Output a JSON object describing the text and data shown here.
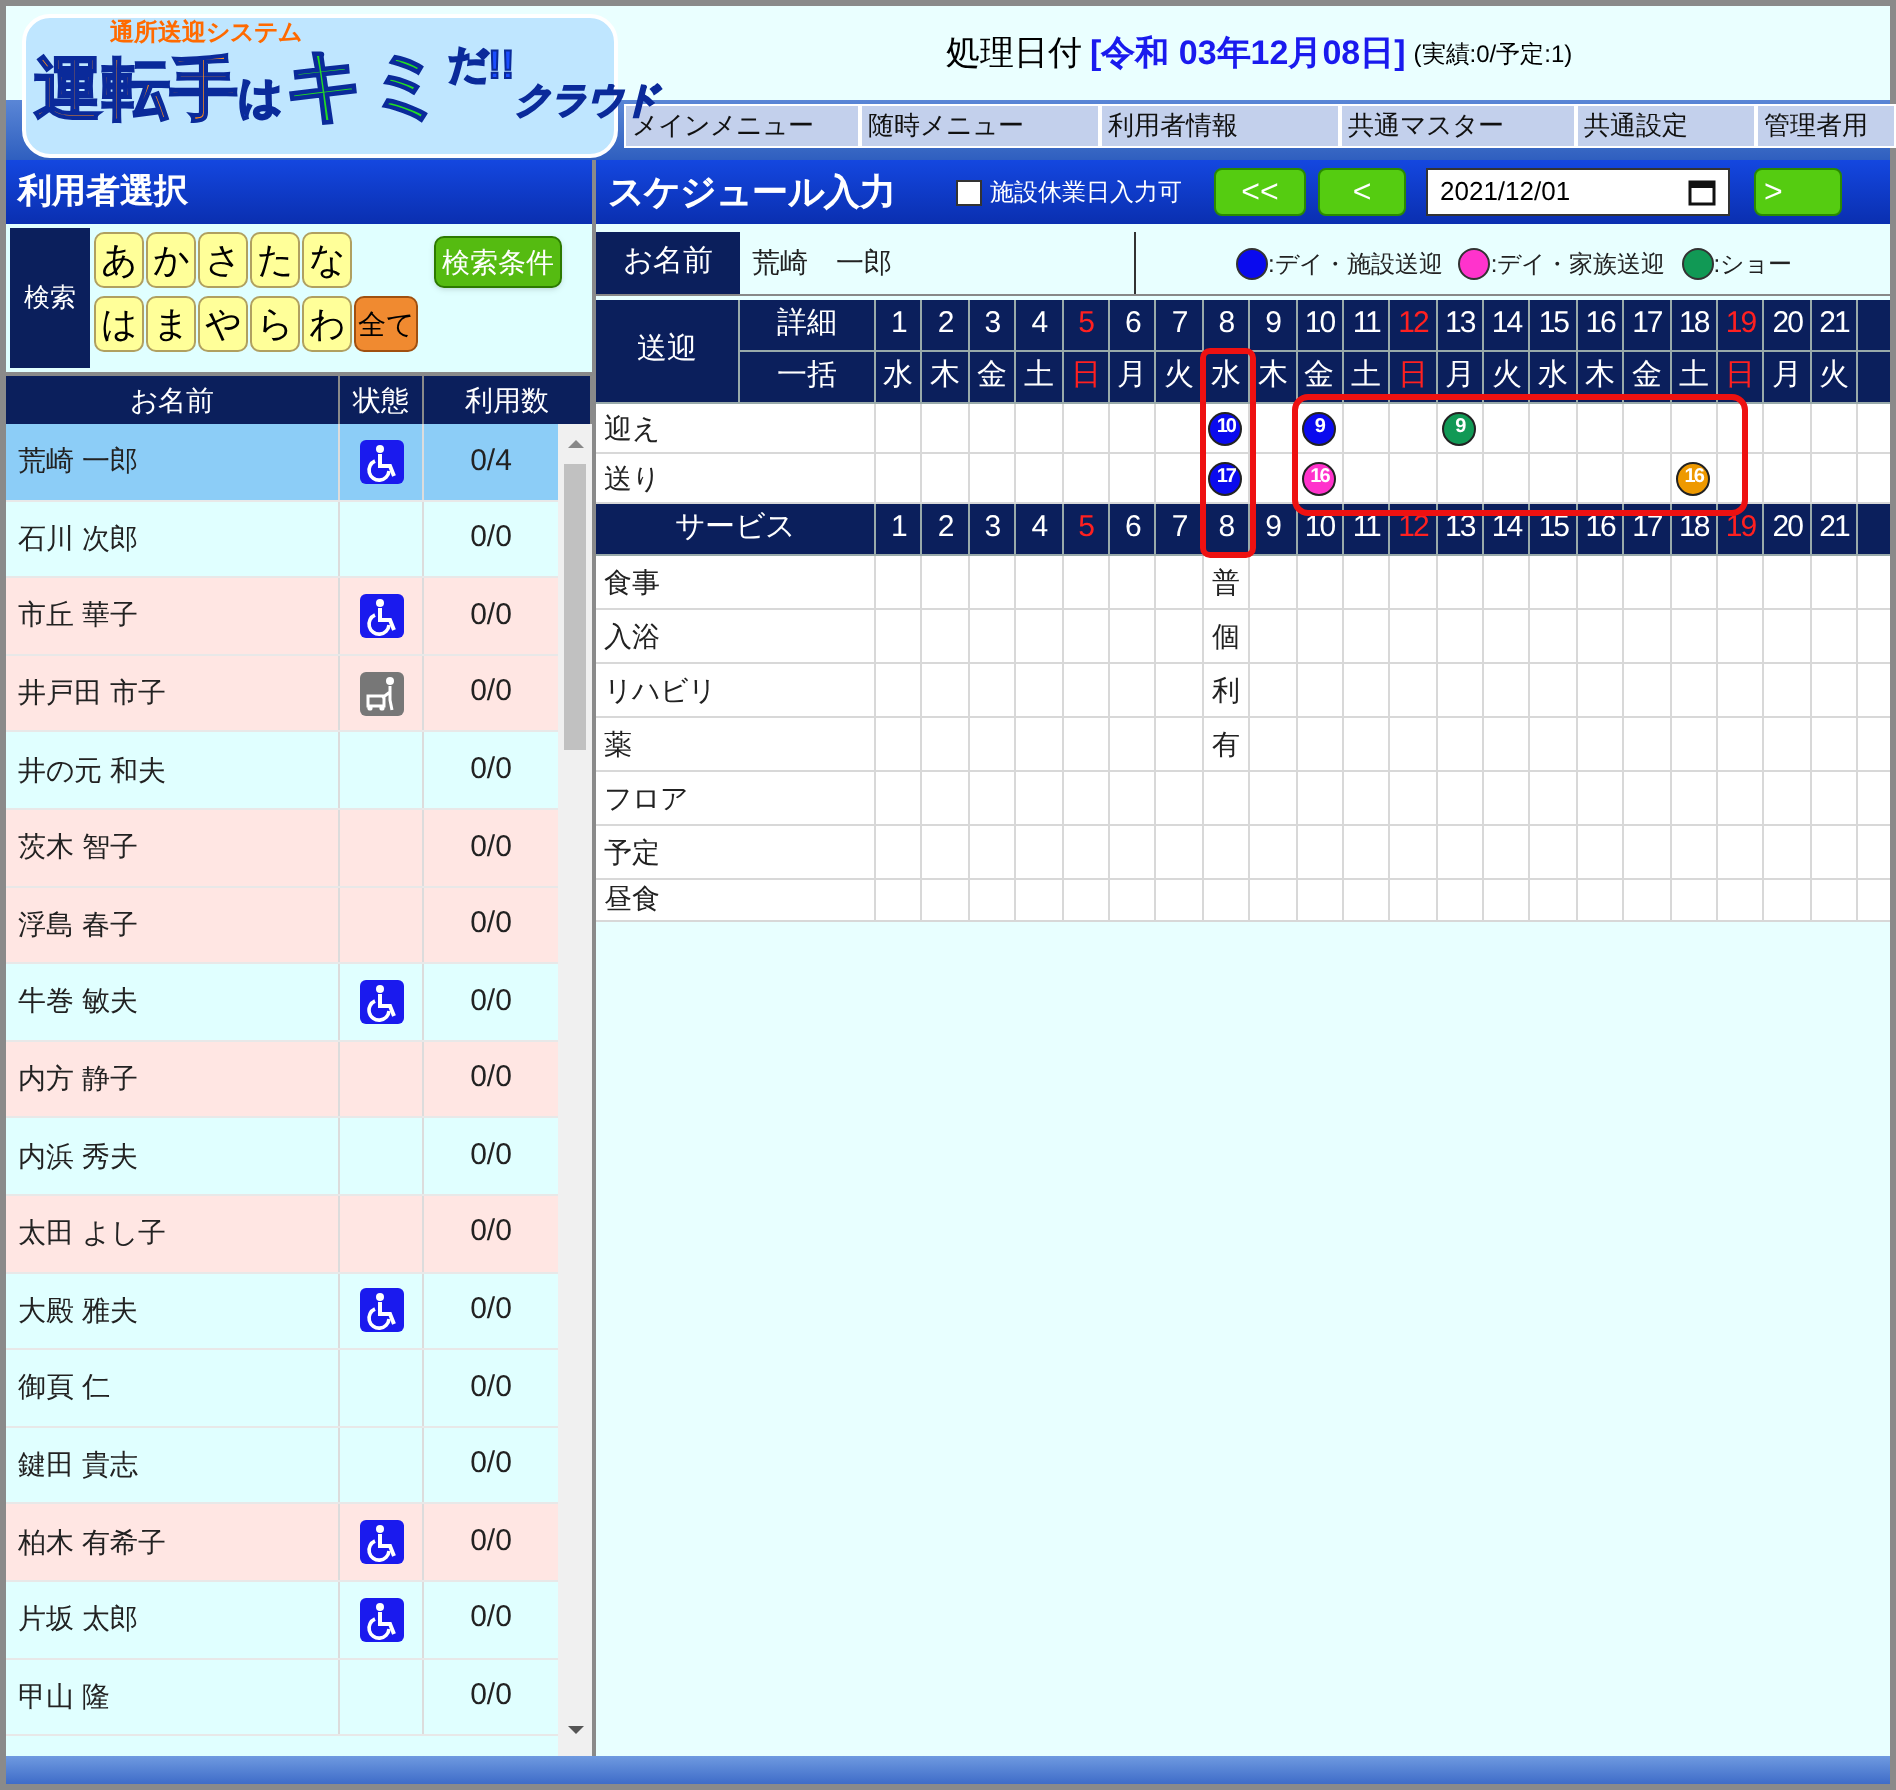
{
  "logo": {
    "tagline": "通所送迎システム",
    "parts": [
      "運転手",
      "は",
      "キミ",
      "だ!!",
      "クラウド"
    ]
  },
  "header": {
    "date_label": "処理日付",
    "date": "[令和 03年12月08日]",
    "counts": "(実績:0/予定:1)"
  },
  "nav": [
    "メインメニュー",
    "随時メニュー",
    "利用者情報",
    "共通マスター",
    "共通設定",
    "管理者用"
  ],
  "user_panel": {
    "title": "利用者選択",
    "search_label": "検索",
    "kana_rows": [
      [
        {
          "text": "あ",
          "kind": "kana"
        },
        {
          "text": "か",
          "kind": "kana"
        },
        {
          "text": "さ",
          "kind": "kana"
        },
        {
          "text": "た",
          "kind": "kana"
        },
        {
          "text": "な",
          "kind": "kana"
        }
      ],
      [
        {
          "text": "は",
          "kind": "kana"
        },
        {
          "text": "ま",
          "kind": "kana"
        },
        {
          "text": "や",
          "kind": "kana"
        },
        {
          "text": "ら",
          "kind": "kana"
        },
        {
          "text": "わ",
          "kind": "kana"
        },
        {
          "text": "全て",
          "kind": "all"
        }
      ]
    ],
    "search_conditions_button": "検索条件",
    "columns": [
      "お名前",
      "状態",
      "利用数"
    ],
    "users": [
      {
        "name": "荒崎 一郎",
        "kind": "wheelchair",
        "count": "0/4",
        "selected": true
      },
      {
        "name": "石川 次郎",
        "count": "0/0",
        "color": "#e0ffff",
        "selected": false
      },
      {
        "name": "市丘 華子",
        "kind": "wheelchair",
        "count": "0/0",
        "color": "#ffe6e3",
        "selected": false
      },
      {
        "name": "井戸田 市子",
        "kind": "walker",
        "count": "0/0",
        "color": "#ffe6e3",
        "selected": false
      },
      {
        "name": "井の元 和夫",
        "count": "0/0",
        "color": "#e0ffff",
        "selected": false
      },
      {
        "name": "茨木 智子",
        "count": "0/0",
        "color": "#ffe6e3",
        "selected": false
      },
      {
        "name": "浮島 春子",
        "count": "0/0",
        "color": "#ffe6e3",
        "selected": false
      },
      {
        "name": "牛巻 敏夫",
        "kind": "wheelchair",
        "count": "0/0",
        "color": "#e0ffff",
        "selected": false
      },
      {
        "name": "内方 静子",
        "count": "0/0",
        "color": "#ffe6e3",
        "selected": false
      },
      {
        "name": "内浜 秀夫",
        "count": "0/0",
        "color": "#e0ffff",
        "selected": false
      },
      {
        "name": "太田 よし子",
        "count": "0/0",
        "color": "#ffe6e3",
        "selected": false
      },
      {
        "name": "大殿 雅夫",
        "kind": "wheelchair",
        "count": "0/0",
        "color": "#e0ffff",
        "selected": false
      },
      {
        "name": "御頁 仁",
        "count": "0/0",
        "color": "#e0ffff",
        "selected": false
      },
      {
        "name": "鍵田 貴志",
        "count": "0/0",
        "color": "#e0ffff",
        "selected": false
      },
      {
        "name": "柏木 有希子",
        "kind": "wheelchair",
        "count": "0/0",
        "color": "#ffe6e3",
        "selected": false
      },
      {
        "name": "片坂 太郎",
        "kind": "wheelchair",
        "count": "0/0",
        "color": "#e0ffff",
        "selected": false
      },
      {
        "name": "甲山 隆",
        "count": "0/0",
        "color": "#e0ffff",
        "selected": false
      }
    ]
  },
  "schedule": {
    "title": "スケジュール入力",
    "closed_day_checkbox": {
      "label": "施設休業日入力可",
      "checked": false
    },
    "buttons": [
      "<<",
      "<"
    ],
    "date": "2021/12/01",
    "next_button": ">",
    "name_label": "お名前",
    "name": "荒崎　一郎",
    "legend": [
      {
        "label": ":デイ・施設送迎",
        "color": "#0a0aee"
      },
      {
        "label": ":デイ・家族送迎",
        "color": "#ff33cc"
      },
      {
        "label": ":ショー",
        "color": "#119955"
      }
    ],
    "transport_label": "送迎",
    "detail_label": "詳細",
    "bulk_label": "一括",
    "row_labels": [
      "迎え",
      "送り"
    ],
    "service_label": "サービス",
    "service_rows": [
      "食事",
      "入浴",
      "リハビリ",
      "薬",
      "フロア",
      "予定",
      "昼食"
    ],
    "days": [
      {
        "day": "1",
        "weekday": "水",
        "sunday": false
      },
      {
        "day": "2",
        "weekday": "木",
        "sunday": false
      },
      {
        "day": "3",
        "weekday": "金",
        "sunday": false
      },
      {
        "day": "4",
        "weekday": "土",
        "sunday": false
      },
      {
        "day": "5",
        "weekday": "日",
        "sunday": true
      },
      {
        "day": "6",
        "weekday": "月",
        "sunday": false
      },
      {
        "day": "7",
        "weekday": "火",
        "sunday": false
      },
      {
        "day": "8",
        "weekday": "水",
        "sunday": false,
        "pickup": {
          "text": "10",
          "color": "#0a0aee"
        },
        "dropoff": {
          "text": "17",
          "color": "#0a0aee"
        },
        "services": [
          "普",
          "個",
          "利",
          "有"
        ]
      },
      {
        "day": "9",
        "weekday": "木",
        "sunday": false
      },
      {
        "day": "10",
        "weekday": "金",
        "sunday": false,
        "pickup": {
          "text": "9",
          "color": "#0a0aee"
        },
        "dropoff": {
          "text": "16",
          "color": "#ff33cc"
        }
      },
      {
        "day": "11",
        "weekday": "土",
        "sunday": false
      },
      {
        "day": "12",
        "weekday": "日",
        "sunday": true
      },
      {
        "day": "13",
        "weekday": "月",
        "sunday": false,
        "pickup": {
          "text": "9",
          "color": "#119955"
        }
      },
      {
        "day": "14",
        "weekday": "火",
        "sunday": false
      },
      {
        "day": "15",
        "weekday": "水",
        "sunday": false
      },
      {
        "day": "16",
        "weekday": "木",
        "sunday": false
      },
      {
        "day": "17",
        "weekday": "金",
        "sunday": false
      },
      {
        "day": "18",
        "weekday": "土",
        "sunday": false,
        "dropoff": {
          "text": "16",
          "color": "#ee9900"
        }
      },
      {
        "day": "19",
        "weekday": "日",
        "sunday": true
      },
      {
        "day": "20",
        "weekday": "月",
        "sunday": false
      },
      {
        "day": "21",
        "weekday": "火",
        "sunday": false
      }
    ],
    "service_header_days": [
      {
        "day": "1",
        "sunday": false
      },
      {
        "day": "2",
        "sunday": false
      },
      {
        "day": "3",
        "sunday": false
      },
      {
        "day": "4",
        "sunday": false
      },
      {
        "day": "5",
        "sunday": true
      },
      {
        "day": "6",
        "sunday": false
      },
      {
        "day": "7",
        "sunday": false
      },
      {
        "day": "8",
        "sunday": false
      },
      {
        "day": "9",
        "sunday": false
      },
      {
        "day": "10",
        "sunday": false
      },
      {
        "day": "11",
        "sunday": false
      },
      {
        "day": "12",
        "sunday": true
      },
      {
        "day": "13",
        "sunday": false
      },
      {
        "day": "14",
        "sunday": false
      },
      {
        "day": "15",
        "sunday": false
      },
      {
        "day": "16",
        "sunday": false
      },
      {
        "day": "17",
        "sunday": false
      },
      {
        "day": "18",
        "sunday": false
      },
      {
        "day": "19",
        "sunday": true
      },
      {
        "day": "20",
        "sunday": false
      },
      {
        "day": "21",
        "sunday": false
      }
    ]
  }
}
